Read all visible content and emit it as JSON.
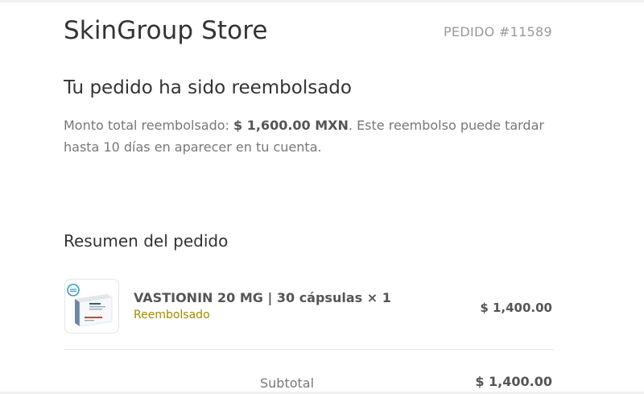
{
  "store": {
    "name": "SkinGroup Store",
    "order_number": "PEDIDO #11589"
  },
  "refund": {
    "heading": "Tu pedido ha sido reembolsado",
    "message_prefix": "Monto total reembolsado: ",
    "amount": "$ 1,600.00 MXN",
    "message_suffix": ". Este reembolso puede tardar hasta 10 días en aparecer en tu cuenta."
  },
  "summary": {
    "title": "Resumen del pedido",
    "items": [
      {
        "name": "VASTIONIN 20 MG | 30 cápsulas × 1",
        "status": "Reembolsado",
        "price": "$ 1,400.00",
        "image_icon": "medicine-box-icon"
      }
    ],
    "subtotal_label": "Subtotal",
    "subtotal_value": "$ 1,400.00"
  },
  "colors": {
    "status_refunded": "#a38a00",
    "text_primary": "#333333",
    "text_muted": "#777777"
  }
}
